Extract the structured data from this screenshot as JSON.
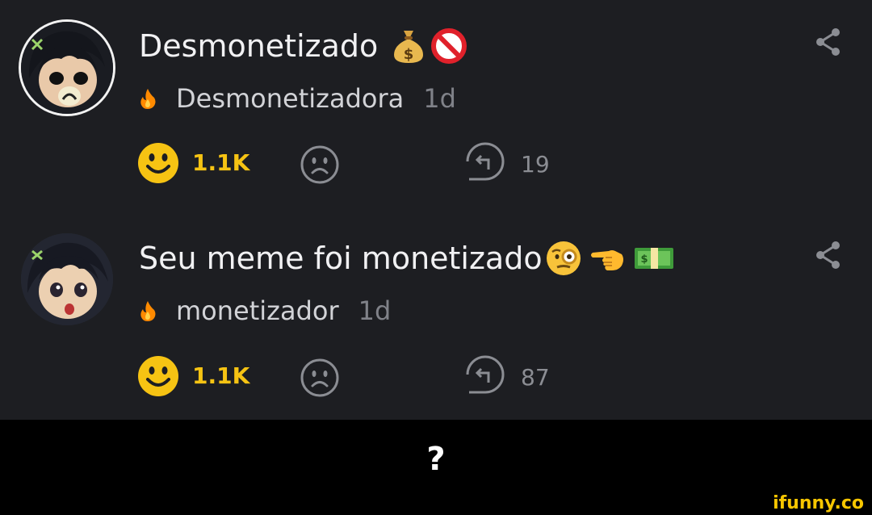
{
  "comments": [
    {
      "title": "Desmonetizado",
      "title_emojis": [
        "money-bag",
        "prohibited"
      ],
      "username": "Desmonetizadora",
      "time": "1d",
      "likes": "1.1K",
      "replies": "19"
    },
    {
      "title": "Seu meme foi monetizado",
      "title_emojis": [
        "face-with-monocle",
        "backhand-index-pointing-left",
        "dollar-banknote"
      ],
      "username": "monetizador",
      "time": "1d",
      "likes": "1.1K",
      "replies": "87"
    }
  ],
  "caption": "?",
  "watermark": "ifunny.co",
  "colors": {
    "background": "#1d1e22",
    "like_yellow": "#f6c313",
    "text_primary": "#f1f1f3",
    "text_secondary": "#808289",
    "flame_orange": "#ff8a00"
  }
}
